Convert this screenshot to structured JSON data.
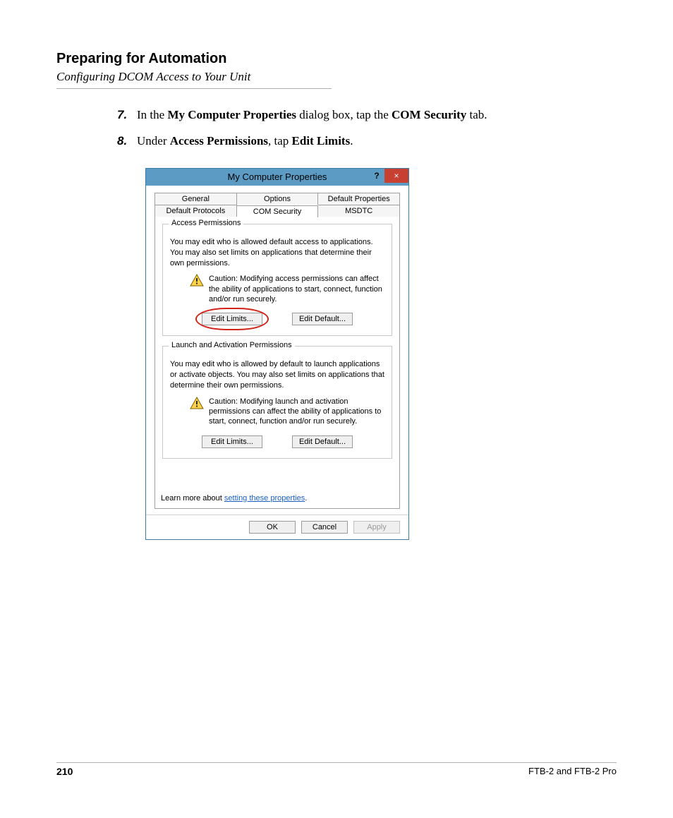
{
  "header": {
    "title": "Preparing for Automation",
    "subtitle": "Configuring DCOM Access to Your Unit"
  },
  "steps": [
    {
      "num": "7.",
      "pre": "In the ",
      "bold1": "My Computer Properties",
      "mid1": " dialog box, tap the ",
      "bold2": "COM Security",
      "post": " tab."
    },
    {
      "num": "8.",
      "pre": "Under ",
      "bold1": "Access Permissions",
      "mid1": ", tap ",
      "bold2": "Edit Limits",
      "post": "."
    }
  ],
  "dialog": {
    "title": "My Computer Properties",
    "help_glyph": "?",
    "close_glyph": "×",
    "tabs_row1": [
      "General",
      "Options",
      "Default Properties"
    ],
    "tabs_row2": [
      "Default Protocols",
      "COM Security",
      "MSDTC"
    ],
    "active_tab": "COM Security",
    "access": {
      "legend": "Access Permissions",
      "text": "You may edit who is allowed default access to applications. You may also set limits on applications that determine their own permissions.",
      "caution": "Caution: Modifying access permissions can affect the ability of applications to start, connect, function and/or run securely.",
      "btn_limits": "Edit Limits...",
      "btn_default": "Edit Default..."
    },
    "launch": {
      "legend": "Launch and Activation Permissions",
      "text": "You may edit who is allowed by default to launch applications or activate objects. You may also set limits on applications that determine their own permissions.",
      "caution": "Caution: Modifying launch and activation permissions can affect the ability of applications to start, connect, function and/or run securely.",
      "btn_limits": "Edit Limits...",
      "btn_default": "Edit Default..."
    },
    "learn_more_pre": "Learn more about ",
    "learn_more_link": "setting these properties",
    "learn_more_post": ".",
    "footer": {
      "ok": "OK",
      "cancel": "Cancel",
      "apply": "Apply"
    }
  },
  "footer": {
    "page_number": "210",
    "product": "FTB-2 and FTB-2 Pro"
  }
}
